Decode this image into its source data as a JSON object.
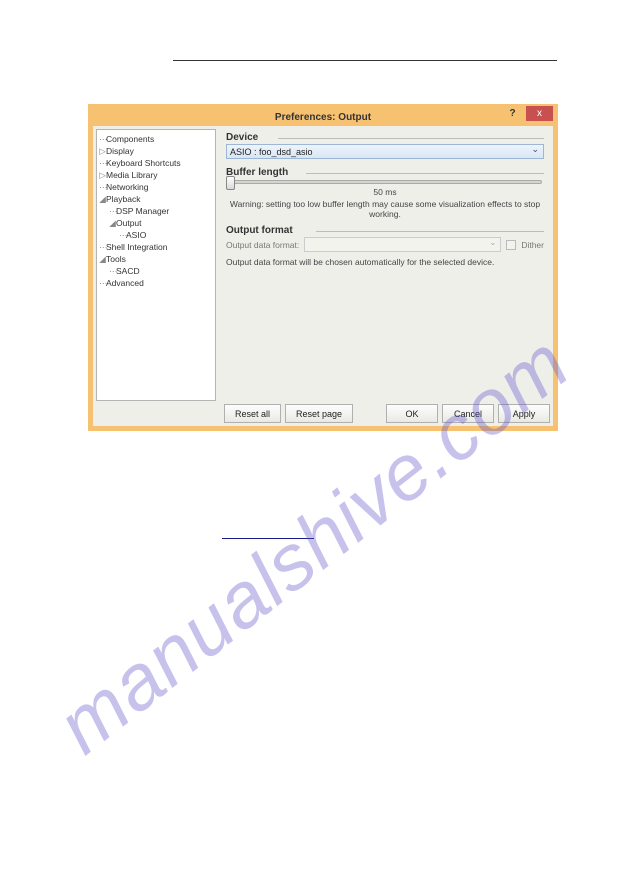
{
  "title": "Preferences: Output",
  "help": "?",
  "close": "x",
  "tree": {
    "components": "Components",
    "display": "Display",
    "keyboard": "Keyboard Shortcuts",
    "media": "Media Library",
    "networking": "Networking",
    "playback": "Playback",
    "dsp": "DSP Manager",
    "output": "Output",
    "asio": "ASIO",
    "shell": "Shell Integration",
    "tools": "Tools",
    "sacd": "SACD",
    "advanced": "Advanced"
  },
  "device": {
    "label": "Device",
    "value": "ASIO : foo_dsd_asio"
  },
  "buffer": {
    "label": "Buffer length",
    "value": "50 ms",
    "warning": "Warning: setting too low buffer length may cause some visualization effects to stop working."
  },
  "format": {
    "label": "Output format",
    "field_label": "Output data format:",
    "dither_label": "Dither",
    "note": "Output data format will be chosen automatically for the selected device."
  },
  "buttons": {
    "reset_all": "Reset all",
    "reset_page": "Reset page",
    "ok": "OK",
    "cancel": "Cancel",
    "apply": "Apply"
  },
  "watermark": "manualshive.com"
}
